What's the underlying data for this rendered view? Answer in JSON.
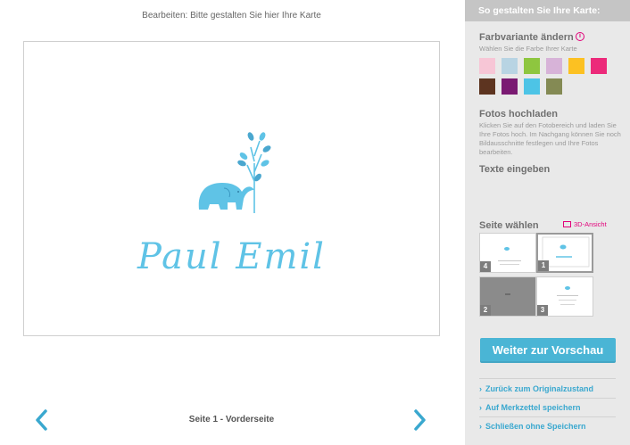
{
  "editor": {
    "heading": "Bearbeiten: Bitte gestalten Sie hier Ihre Karte",
    "card_text": "Paul Emil",
    "page_label": "Seite 1 - Vorderseite"
  },
  "sidebar": {
    "header": "So gestalten Sie Ihre Karte:",
    "color_section": {
      "title": "Farbvariante ändern",
      "subtitle": "Wählen Sie die Farbe Ihrer Karte",
      "info_icon": "i",
      "swatches": [
        "#f7c6d6",
        "#b8d4e3",
        "#8ec63f",
        "#d7b3d8",
        "#fcc122",
        "#ec2a7a",
        "#5d3420",
        "#7a1a72",
        "#4dc4e6",
        "#848a54"
      ]
    },
    "photo_section": {
      "title": "Fotos hochladen",
      "text": "Klicken Sie auf den Fotobereich und laden Sie Ihre Fotos hoch. Im Nachgang können Sie noch Bildausschnitte festlegen und Ihre Fotos bearbeiten."
    },
    "text_section": {
      "title": "Texte eingeben"
    },
    "page_section": {
      "title": "Seite wählen",
      "view3d": "3D-Ansicht",
      "thumbs": [
        "4",
        "1",
        "2",
        "3"
      ]
    },
    "preview_button": "Weiter zur Vorschau",
    "links": {
      "reset": "Zurück zum Originalzustand",
      "save": "Auf Merkzettel speichern",
      "close": "Schließen ohne Speichern"
    }
  },
  "colors": {
    "accent": "#4ab5d5",
    "card_text": "#5fc3e6",
    "highlight": "#e2007a"
  }
}
